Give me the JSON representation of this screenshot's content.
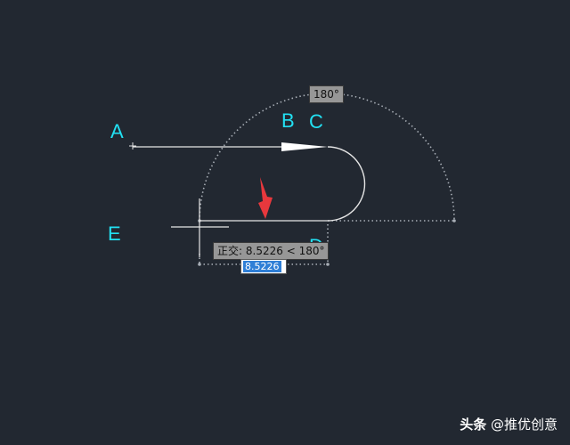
{
  "labels": {
    "a": "A",
    "b": "B",
    "c": "C",
    "d": "D",
    "e": "E"
  },
  "angle_tooltip": {
    "value": "180°"
  },
  "ortho_tooltip": {
    "mode": "正交",
    "length": "8.5226",
    "angle": "180°"
  },
  "length_input": {
    "value": "8.5226"
  },
  "watermark": {
    "brand": "头条",
    "handle": "@推优创意"
  },
  "colors": {
    "background": "#222831",
    "label": "#22e0f2",
    "geometry": "#e6e6e6",
    "tracking": "#a8aeb6",
    "arrow": "#e8383d",
    "tooltip_bg": "#979797",
    "input_selection": "#2f7fd6"
  }
}
